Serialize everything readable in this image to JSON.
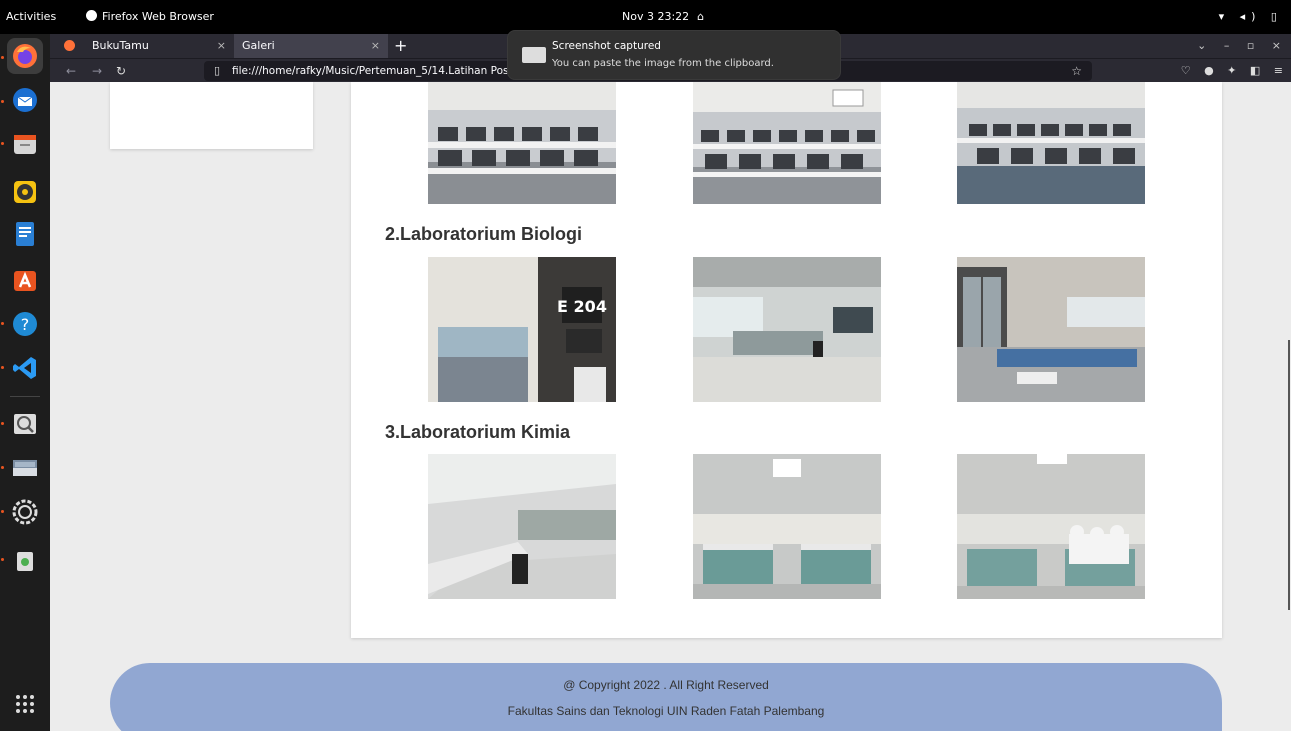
{
  "topbar": {
    "activities": "Activities",
    "app_name": "Firefox Web Browser",
    "clock": "Nov 3  23:22",
    "system_icons": "▾ ◂) ▯"
  },
  "tabs": [
    {
      "title": "BukuTamu",
      "close": "×"
    },
    {
      "title": "Galeri",
      "close": "×"
    }
  ],
  "new_tab": "+",
  "tab_right": "⌄ – ▫ ×",
  "nav": {
    "url": "file:///home/rafky/Music/Pertemuan_5/14.Latihan Position",
    "star": "☆",
    "right_icons": "♡ ● ✦ ◧ ≡"
  },
  "notification": {
    "title": "Screenshot captured",
    "body": "You can paste the image from the clipboard."
  },
  "sections": [
    {
      "title": "2.Laboratorium Biologi"
    },
    {
      "title": "3.Laboratorium Kimia"
    }
  ],
  "footer": {
    "copyright": "@ Copyright 2022 . All Right Reserved",
    "faculty": "Fakultas Sains dan Teknologi UIN Raden Fatah Palembang"
  },
  "colors": {
    "footer_bg": "#91a7d2",
    "accent": "#e95420"
  }
}
